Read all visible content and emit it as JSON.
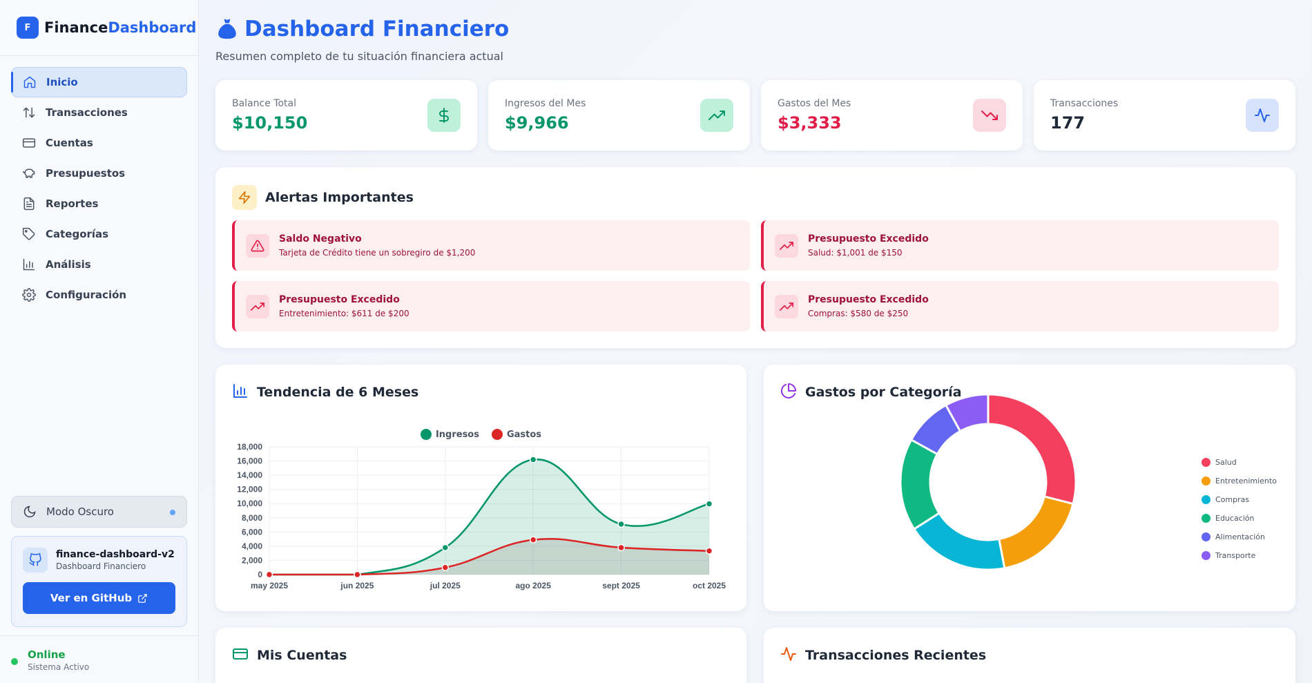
{
  "brand": {
    "logo_letter": "F",
    "name_plain": "Finance",
    "name_accent": "Dashboard"
  },
  "sidebar": {
    "items": [
      {
        "label": "Inicio",
        "icon": "home-icon",
        "active": true
      },
      {
        "label": "Transacciones",
        "icon": "arrows-up-down-icon"
      },
      {
        "label": "Cuentas",
        "icon": "credit-card-icon"
      },
      {
        "label": "Presupuestos",
        "icon": "piggy-bank-icon"
      },
      {
        "label": "Reportes",
        "icon": "file-text-icon"
      },
      {
        "label": "Categorías",
        "icon": "tag-icon"
      },
      {
        "label": "Análisis",
        "icon": "bar-chart-icon"
      },
      {
        "label": "Configuración",
        "icon": "gear-icon"
      }
    ],
    "dark_mode_label": "Modo Oscuro",
    "repo": {
      "name": "finance-dashboard-v2",
      "subtitle": "Dashboard Financiero",
      "button_label": "Ver en GitHub"
    },
    "status": {
      "label": "Online",
      "subtitle": "Sistema Activo"
    }
  },
  "header": {
    "title": "Dashboard Financiero",
    "subtitle": "Resumen completo de tu situación financiera actual"
  },
  "stats": [
    {
      "label": "Balance Total",
      "value": "$10,150",
      "color": "#059669",
      "icon": "dollar-icon"
    },
    {
      "label": "Ingresos del Mes",
      "value": "$9,966",
      "color": "#059669",
      "icon": "trending-up-icon"
    },
    {
      "label": "Gastos del Mes",
      "value": "$3,333",
      "color": "#e11d48",
      "icon": "trending-down-icon"
    },
    {
      "label": "Transacciones",
      "value": "177",
      "color": "#1f2937",
      "icon": "activity-icon"
    }
  ],
  "alerts": {
    "title": "Alertas Importantes",
    "items": [
      {
        "title": "Saldo Negativo",
        "desc": "Tarjeta de Crédito tiene un sobregiro de $1,200",
        "icon": "warning-triangle-icon"
      },
      {
        "title": "Presupuesto Excedido",
        "desc": "Salud: $1,001 de $150",
        "icon": "trending-up-icon"
      },
      {
        "title": "Presupuesto Excedido",
        "desc": "Entretenimiento: $611 de $200",
        "icon": "trending-up-icon"
      },
      {
        "title": "Presupuesto Excedido",
        "desc": "Compras: $580 de $250",
        "icon": "trending-up-icon"
      }
    ]
  },
  "trend": {
    "title": "Tendencia de 6 Meses"
  },
  "categories_section": {
    "title": "Gastos por Categoría"
  },
  "accounts_section": {
    "title": "Mis Cuentas"
  },
  "recent_section": {
    "title": "Transacciones Recientes"
  },
  "chart_data": [
    {
      "type": "area",
      "x": [
        "may 2025",
        "jun 2025",
        "jul 2025",
        "ago 2025",
        "sept 2025",
        "oct 2025"
      ],
      "series": [
        {
          "name": "Ingresos",
          "values": [
            0,
            0,
            3800,
            16200,
            7100,
            9966
          ],
          "color": "#059669"
        },
        {
          "name": "Gastos",
          "values": [
            0,
            0,
            1000,
            4900,
            3800,
            3333
          ],
          "color": "#dc2626"
        }
      ],
      "yticks": [
        0,
        2000,
        4000,
        6000,
        8000,
        10000,
        12000,
        14000,
        16000,
        18000
      ],
      "ytick_labels": [
        "0",
        "2,000",
        "4,000",
        "6,000",
        "8,000",
        "10,000",
        "12,000",
        "14,000",
        "16,000",
        "18,000"
      ],
      "ylim": [
        0,
        18000
      ],
      "grid": true,
      "legend": "top-center"
    },
    {
      "type": "pie",
      "categories": [
        "Salud",
        "Entretenimiento",
        "Compras",
        "Educación",
        "Alimentación",
        "Transporte"
      ],
      "values": [
        29,
        18,
        19,
        17,
        9,
        8
      ],
      "colors": [
        "#f43f5e",
        "#f59e0b",
        "#06b6d4",
        "#10b981",
        "#6366f1",
        "#8b5cf6"
      ],
      "legend": "right"
    }
  ]
}
